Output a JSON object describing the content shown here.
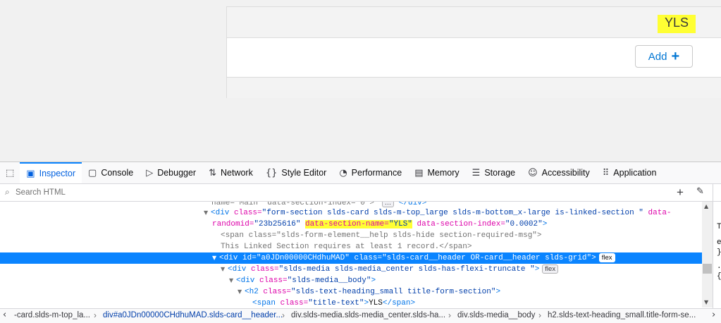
{
  "page": {
    "card_title": "YLS",
    "add_button_label": "Add",
    "add_button_icon": "+"
  },
  "devtools": {
    "tabs": [
      {
        "label": "Inspector",
        "icon": "inspector-icon",
        "active": true
      },
      {
        "label": "Console",
        "icon": "console-icon"
      },
      {
        "label": "Debugger",
        "icon": "debugger-icon"
      },
      {
        "label": "Network",
        "icon": "network-icon"
      },
      {
        "label": "Style Editor",
        "icon": "style-editor-icon"
      },
      {
        "label": "Performance",
        "icon": "performance-icon"
      },
      {
        "label": "Memory",
        "icon": "memory-icon"
      },
      {
        "label": "Storage",
        "icon": "storage-icon"
      },
      {
        "label": "Accessibility",
        "icon": "accessibility-icon"
      },
      {
        "label": "Application",
        "icon": "application-icon"
      }
    ],
    "search_placeholder": "Search HTML",
    "accent_color": "#0a84ff",
    "highlight_color": "#ffff33",
    "tree": {
      "l0": "name=\"Main\" data-section-index=\"0\">",
      "l0_close": "</div>",
      "l1_tag": "<div",
      "l1_attr_class": "class=",
      "l1_val_class": "\"form-section slds-card slds-m-top_large slds-m-bottom_x-large is-linked-section \"",
      "l1_attr_random": "data-",
      "l2_attr_random": "randomid=",
      "l2_val_random": "\"23b25616\"",
      "l2_attr_name": "data-section-name=",
      "l2_val_name": "\"YLS\"",
      "l2_attr_index": "data-section-index=",
      "l2_val_index": "\"0.0002\"",
      "l2_end": ">",
      "l3_tag": "<span",
      "l3_attr": "class=",
      "l3_val": "\"slds-form-element__help slds-hide section-required-msg\"",
      "l3_end": ">",
      "l4_text": "This Linked Section requires at least 1 record.",
      "l4_close": "</span>",
      "l5_tag": "<div",
      "l5_attr_id": "id=",
      "l5_val_id": "\"a0JDn00000CHdhuMAD\"",
      "l5_attr_class": "class=",
      "l5_val_class": "\"slds-card__header OR-card__header slds-grid\"",
      "l5_end": ">",
      "l5_badge": "flex",
      "l6_tag": "<div",
      "l6_attr": "class=",
      "l6_val": "\"slds-media slds-media_center slds-has-flexi-truncate \"",
      "l6_end": ">",
      "l6_badge": "flex",
      "l7_tag": "<div",
      "l7_attr": "class=",
      "l7_val": "\"slds-media__body\"",
      "l7_end": ">",
      "l8_tag": "<h2",
      "l8_attr": "class=",
      "l8_val": "\"slds-text-heading_small title-form-section\"",
      "l8_end": ">",
      "l9_tag": "<span",
      "l9_attr": "class=",
      "l9_val": "\"title-text\"",
      "l9_mid": ">",
      "l9_text": "YLS",
      "l9_close": "</span>"
    },
    "rules_pane": [
      "T",
      "e",
      "}",
      ".",
      "{"
    ],
    "breadcrumbs": [
      {
        "tag": "-card.slds-m-top_la..."
      },
      {
        "tag": "div",
        "id": "#a0JDn00000CHdhuMAD.slds-card__header..."
      },
      {
        "tag": "div",
        "rest": ".slds-media.slds-media_center.slds-ha..."
      },
      {
        "tag": "div",
        "rest": ".slds-media__body"
      },
      {
        "tag": "h2",
        "rest": ".slds-text-heading_small.title-form-se..."
      }
    ]
  }
}
